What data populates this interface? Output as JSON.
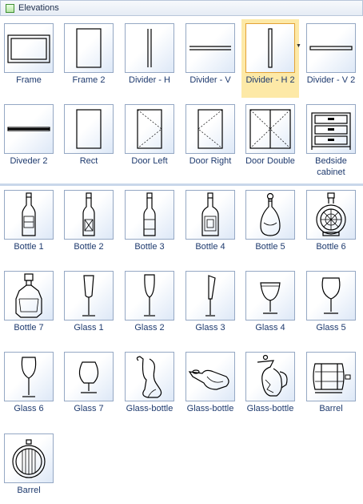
{
  "elevations": {
    "title": "Elevations",
    "items": [
      {
        "label": "Frame",
        "icon": "frame-icon"
      },
      {
        "label": "Frame 2",
        "icon": "frame-2-icon"
      },
      {
        "label": "Divider - H",
        "icon": "divider-h-icon"
      },
      {
        "label": "Divider - V",
        "icon": "divider-v-icon"
      },
      {
        "label": "Divider - H 2",
        "icon": "divider-h-2-icon",
        "selected": true
      },
      {
        "label": "Divider - V 2",
        "icon": "divider-v-2-icon"
      },
      {
        "label": "Diveder 2",
        "icon": "diveder-2-icon"
      },
      {
        "label": "Rect",
        "icon": "rect-icon"
      },
      {
        "label": "Door Left",
        "icon": "door-left-icon"
      },
      {
        "label": "Door Right",
        "icon": "door-right-icon"
      },
      {
        "label": "Door Double",
        "icon": "door-double-icon"
      },
      {
        "label": "Bedside cabinet",
        "icon": "bedside-cabinet-icon"
      }
    ]
  },
  "bottles": {
    "items": [
      {
        "label": "Bottle 1",
        "icon": "bottle-1-icon"
      },
      {
        "label": "Bottle 2",
        "icon": "bottle-2-icon"
      },
      {
        "label": "Bottle 3",
        "icon": "bottle-3-icon"
      },
      {
        "label": "Bottle 4",
        "icon": "bottle-4-icon"
      },
      {
        "label": "Bottle 5",
        "icon": "bottle-5-icon"
      },
      {
        "label": "Bottle 6",
        "icon": "bottle-6-icon"
      },
      {
        "label": "Bottle 7",
        "icon": "bottle-7-icon"
      },
      {
        "label": "Glass 1",
        "icon": "glass-1-icon"
      },
      {
        "label": "Glass 2",
        "icon": "glass-2-icon"
      },
      {
        "label": "Glass 3",
        "icon": "glass-3-icon"
      },
      {
        "label": "Glass 4",
        "icon": "glass-4-icon"
      },
      {
        "label": "Glass 5",
        "icon": "glass-5-icon"
      },
      {
        "label": "Glass 6",
        "icon": "glass-6-icon"
      },
      {
        "label": "Glass 7",
        "icon": "glass-7-icon"
      },
      {
        "label": "Glass-bottle",
        "icon": "glass-bottle-1-icon"
      },
      {
        "label": "Glass-bottle",
        "icon": "glass-bottle-2-icon"
      },
      {
        "label": "Glass-bottle",
        "icon": "glass-bottle-3-icon"
      },
      {
        "label": "Barrel",
        "icon": "barrel-1-icon"
      },
      {
        "label": "Barrel",
        "icon": "barrel-2-icon"
      }
    ]
  },
  "colors": {
    "label_text": "#1e3a6e",
    "selected_bg": "#fde9a7",
    "tile_border": "#95a8c4"
  }
}
